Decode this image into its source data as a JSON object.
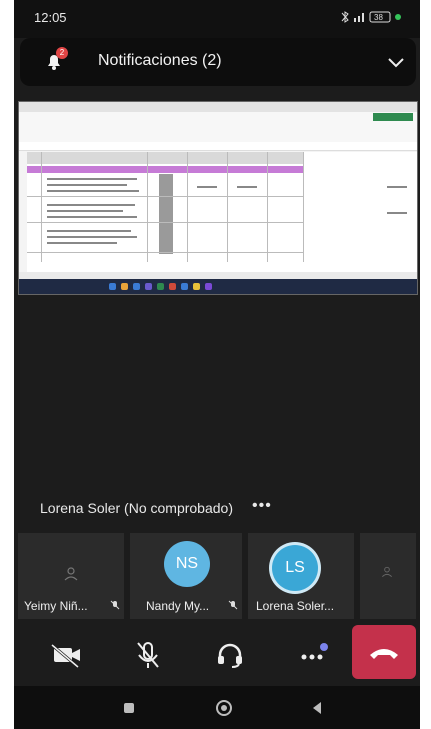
{
  "status_bar": {
    "time": "12:05",
    "battery_text": "38"
  },
  "notification": {
    "label": "Notificaciones (2)",
    "count": "2"
  },
  "presenter": {
    "label": "Lorena Soler (No comprobado)",
    "more_label": "•••"
  },
  "participants": [
    {
      "name": "Yeimy Niñ...",
      "initials": ""
    },
    {
      "name": "Nandy My...",
      "initials": "NS"
    },
    {
      "name": "Lorena Soler...",
      "initials": "LS"
    }
  ],
  "colors": {
    "hangup": "#c4314b",
    "avatar_ns": "#5fb6e2",
    "avatar_ls": "#3aa7d6",
    "badge": "#e04545"
  },
  "icons": {
    "camera_off": "camera-off-icon",
    "mic_off": "mic-off-icon",
    "audio": "headset-icon",
    "more": "more-icon",
    "hangup": "hangup-icon"
  }
}
